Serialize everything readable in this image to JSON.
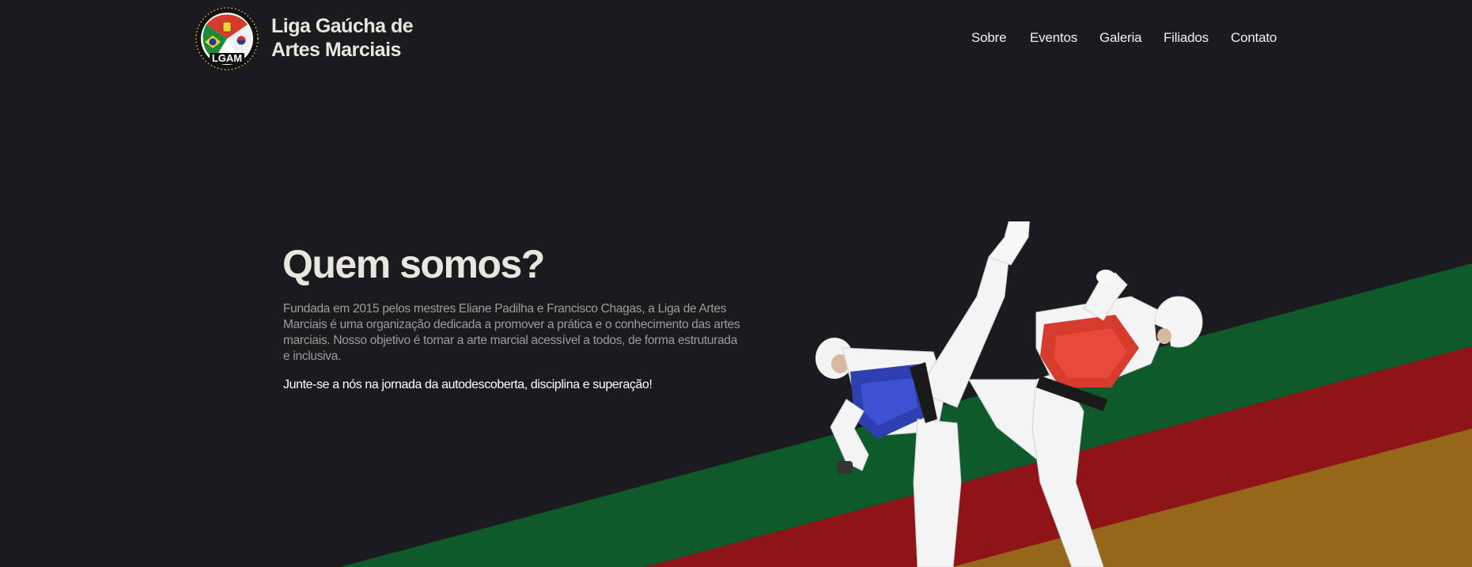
{
  "brand": {
    "name_line1": "Liga Gaúcha de",
    "name_line2": "Artes Marciais",
    "logo_text": "LGAM"
  },
  "nav": {
    "items": [
      {
        "label": "Sobre"
      },
      {
        "label": "Eventos"
      },
      {
        "label": "Galeria"
      },
      {
        "label": "Filiados"
      },
      {
        "label": "Contato"
      }
    ]
  },
  "hero": {
    "title": "Quem somos?",
    "description": "Fundada em 2015 pelos mestres Eliane Padilha e Francisco Chagas, a Liga de Artes Marciais é uma organização dedicada a promover a prática e o conhecimento das artes marciais. Nosso objetivo é tornar a arte marcial acessível a todos, de forma estruturada e inclusiva.",
    "cta": "Junte-se a nós na jornada da autodescoberta, disciplina e superação!"
  },
  "colors": {
    "background": "#1b1b1f",
    "stripe_green": "#0f5a2b",
    "stripe_red": "#8e1418",
    "stripe_gold": "#96671b",
    "title_text": "#e8e6df",
    "body_text": "#9d9c9a"
  },
  "icons": {
    "logo": "lgam-emblem-icon",
    "fighters": "taekwondo-fighters-illustration"
  }
}
